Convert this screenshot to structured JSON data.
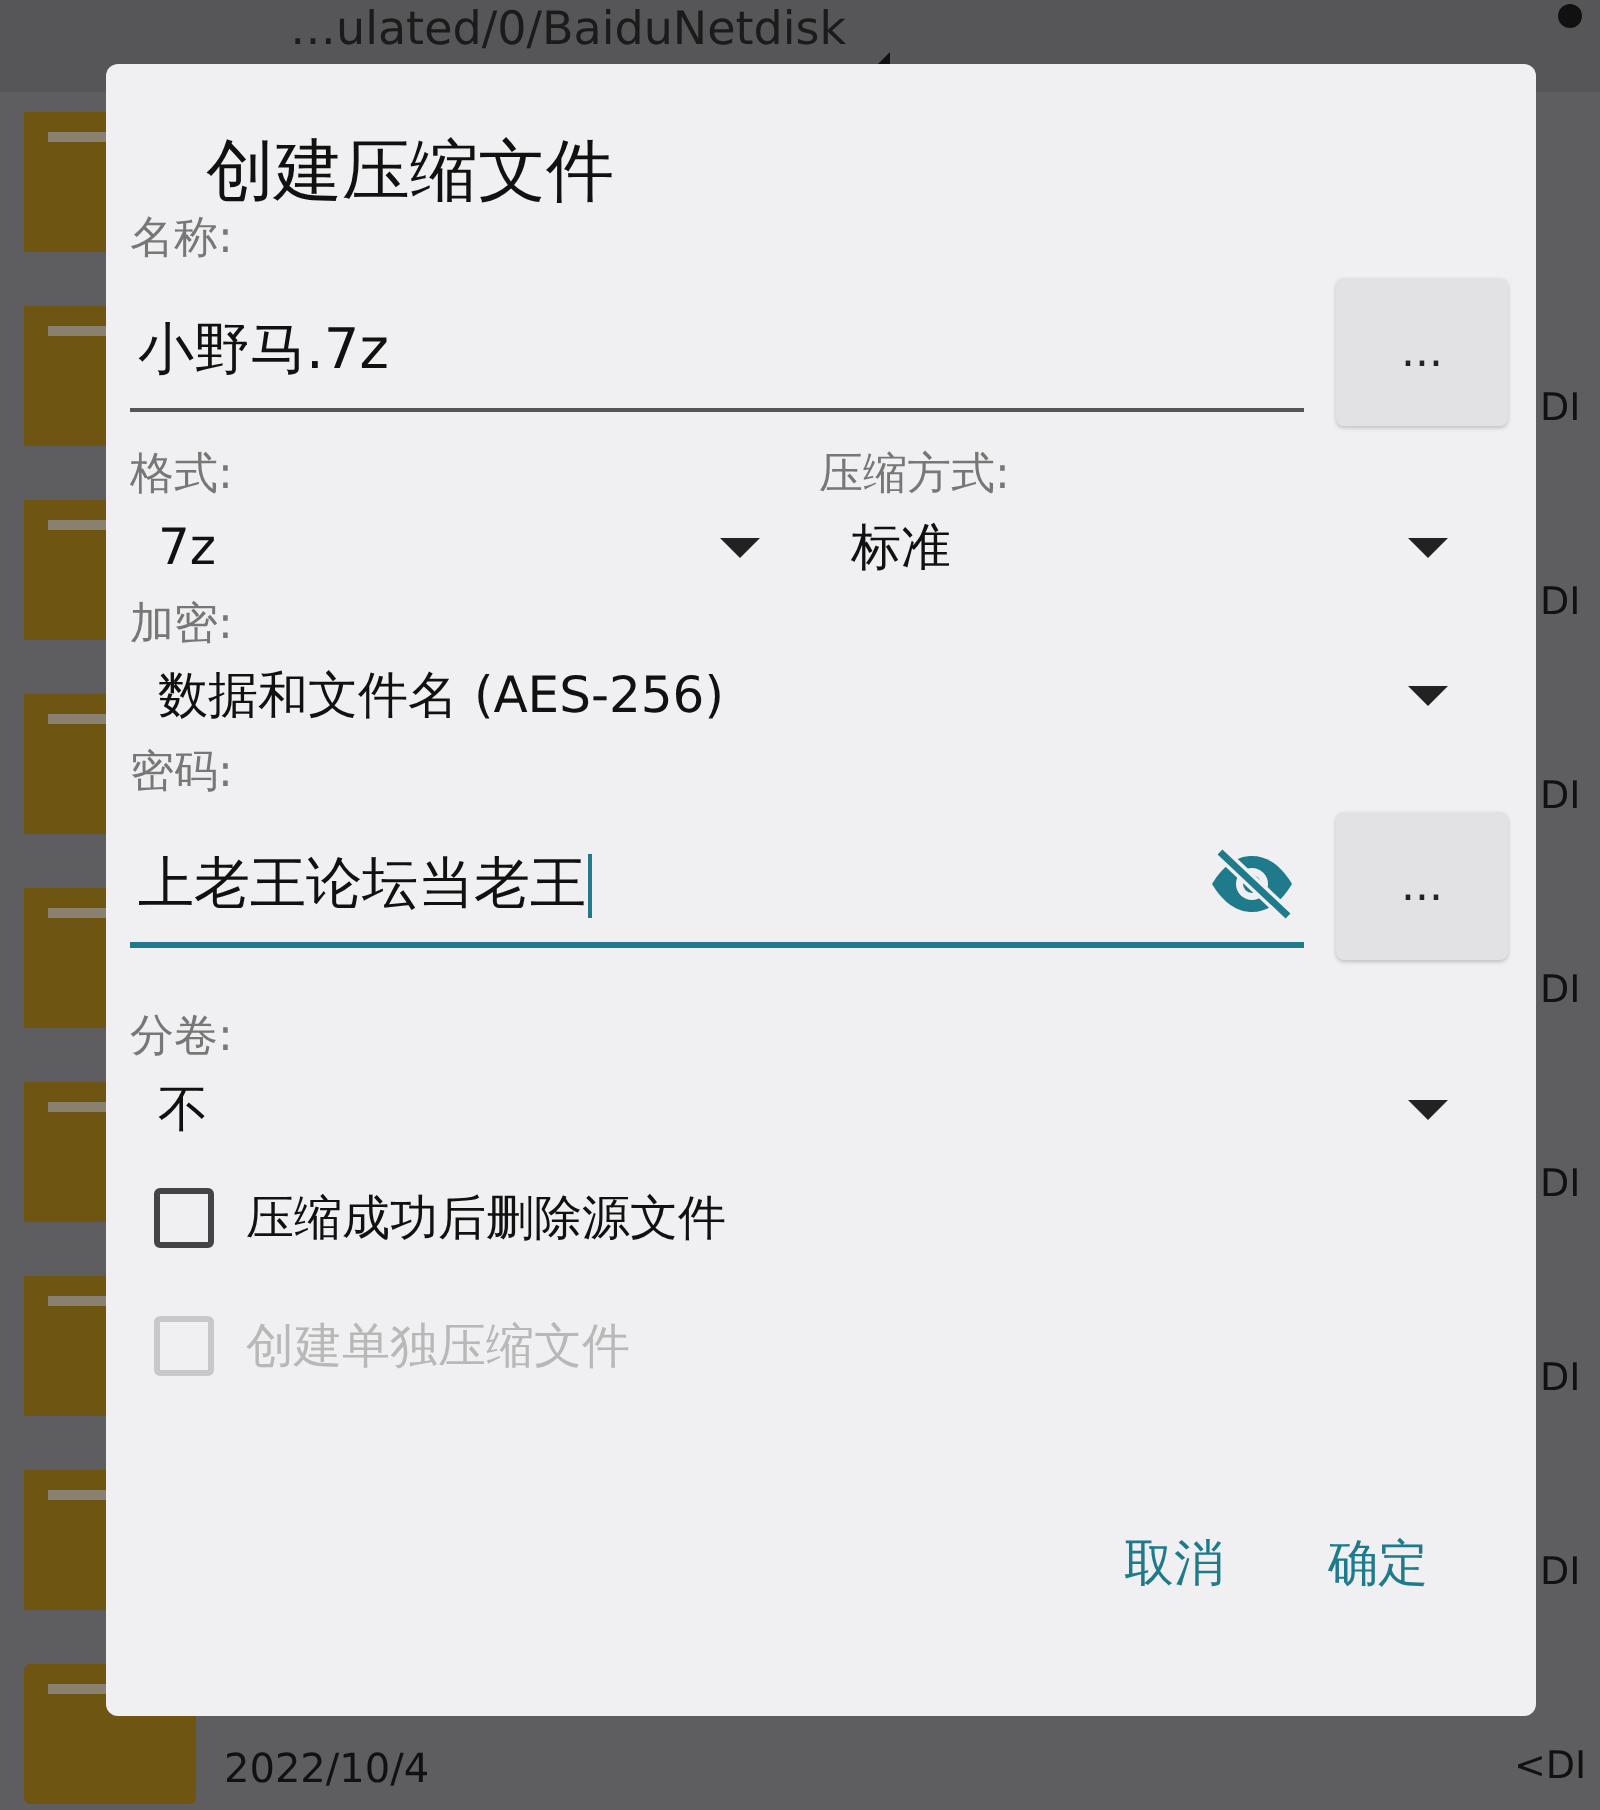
{
  "background": {
    "path": "…ulated/0/BaiduNetdisk",
    "rows": [
      {
        "kind": "folder"
      },
      {
        "kind": "folder",
        "type": "DI"
      },
      {
        "kind": "folder",
        "type": "DI"
      },
      {
        "kind": "folder",
        "type": "DI"
      },
      {
        "kind": "folder",
        "type": "DI"
      },
      {
        "kind": "folder",
        "type": "DI"
      },
      {
        "kind": "folder",
        "type": "DI"
      },
      {
        "kind": "folder",
        "type": "DI"
      },
      {
        "kind": "folder",
        "date": "2022/10/4",
        "type": "<DI"
      }
    ]
  },
  "dialog": {
    "title": "创建压缩文件",
    "name": {
      "label": "名称:",
      "value": "小野马.7z",
      "button": "..."
    },
    "format": {
      "label": "格式:",
      "value": "7z"
    },
    "method": {
      "label": "压缩方式:",
      "value": "标准"
    },
    "encryption": {
      "label": "加密:",
      "value": "数据和文件名 (AES-256)"
    },
    "password": {
      "label": "密码:",
      "value": "上老王论坛当老王",
      "focused": true,
      "button": "..."
    },
    "split": {
      "label": "分卷:",
      "value": "不"
    },
    "checkboxes": [
      {
        "label": "压缩成功后删除源文件",
        "checked": false,
        "disabled": false
      },
      {
        "label": "创建单独压缩文件",
        "checked": false,
        "disabled": true
      }
    ],
    "buttons": [
      "取消",
      "确定"
    ]
  }
}
